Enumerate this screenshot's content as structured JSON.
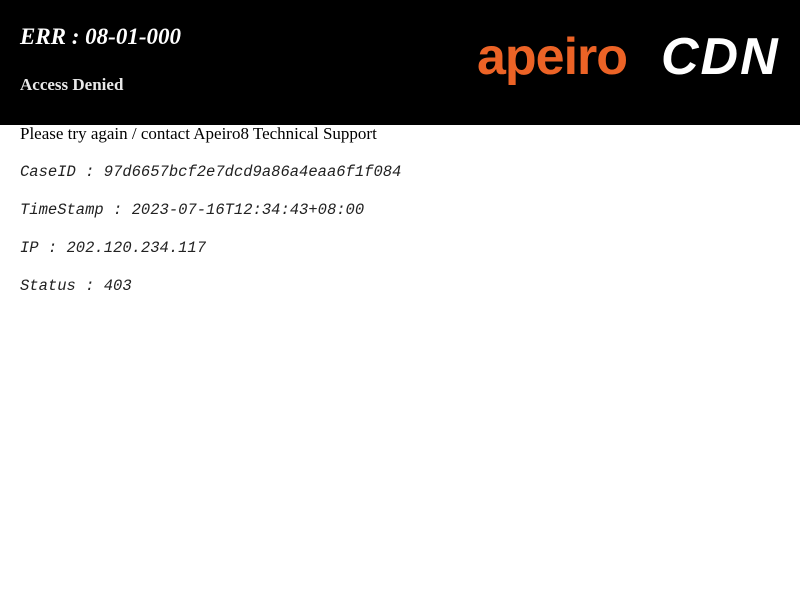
{
  "header": {
    "error_code": "ERR : 08-01-000",
    "error_message": "Access Denied",
    "logo_text_brand": "apeiro",
    "logo_text_product": "CDN",
    "logo_brand_color": "#ec6326",
    "logo_product_color": "#ffffff"
  },
  "content": {
    "instruction": "Please try again / contact Apeiro8 Technical Support",
    "details": [
      "CaseID : 97d6657bcf2e7dcd9a86a4eaa6f1f084",
      "TimeStamp : 2023-07-16T12:34:43+08:00",
      "IP : 202.120.234.117",
      "Status : 403"
    ]
  }
}
